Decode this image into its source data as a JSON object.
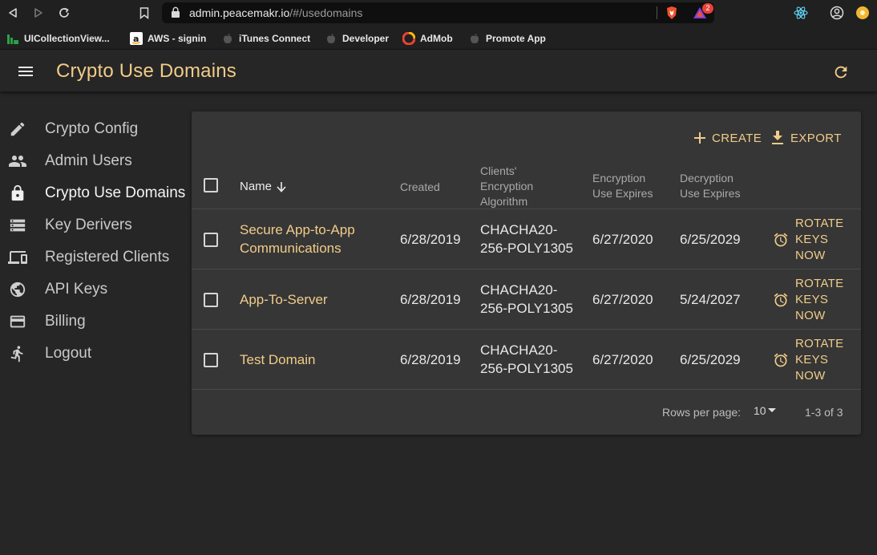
{
  "browser": {
    "url_domain": "admin.peacemakr.io",
    "url_path": "/#/usedomains",
    "shields_badge": "2",
    "bookmarks": [
      "UICollectionView...",
      "AWS - signin",
      "iTunes Connect",
      "Developer",
      "AdMob",
      "Promote App"
    ]
  },
  "appbar": {
    "title": "Crypto Use Domains",
    "menu_icon": "menu-icon",
    "refresh_icon": "refresh-icon"
  },
  "sidebar": {
    "items": [
      {
        "label": "Crypto Config",
        "icon": "pencil-icon",
        "active": false
      },
      {
        "label": "Admin Users",
        "icon": "people-icon",
        "active": false
      },
      {
        "label": "Crypto Use Domains",
        "icon": "lock-icon",
        "active": true
      },
      {
        "label": "Key Derivers",
        "icon": "storage-icon",
        "active": false
      },
      {
        "label": "Registered Clients",
        "icon": "devices-icon",
        "active": false
      },
      {
        "label": "API Keys",
        "icon": "globe-icon",
        "active": false
      },
      {
        "label": "Billing",
        "icon": "credit-card-icon",
        "active": false
      },
      {
        "label": "Logout",
        "icon": "run-icon",
        "active": false
      }
    ]
  },
  "toolbar": {
    "create_label": "CREATE",
    "export_label": "EXPORT"
  },
  "table": {
    "headers": {
      "name": "Name",
      "created": "Created",
      "algorithm": [
        "Clients'",
        "Encryption",
        "Algorithm"
      ],
      "encryption": [
        "Encryption",
        "Use Expires"
      ],
      "decryption": [
        "Decryption",
        "Use Expires"
      ]
    },
    "rows": [
      {
        "name": [
          "Secure App-to-App",
          "Communications"
        ],
        "created": "6/28/2019",
        "algorithm": [
          "CHACHA20-",
          "256-POLY1305"
        ],
        "encryption_expires": "6/27/2020",
        "decryption_expires": "6/25/2029",
        "action": [
          "ROTATE",
          "KEYS",
          "NOW"
        ]
      },
      {
        "name": [
          "App-To-Server"
        ],
        "created": "6/28/2019",
        "algorithm": [
          "CHACHA20-",
          "256-POLY1305"
        ],
        "encryption_expires": "6/27/2020",
        "decryption_expires": "5/24/2027",
        "action": [
          "ROTATE",
          "KEYS",
          "NOW"
        ]
      },
      {
        "name": [
          "Test Domain"
        ],
        "created": "6/28/2019",
        "algorithm": [
          "CHACHA20-",
          "256-POLY1305"
        ],
        "encryption_expires": "6/27/2020",
        "decryption_expires": "6/25/2029",
        "action": [
          "ROTATE",
          "KEYS",
          "NOW"
        ]
      }
    ]
  },
  "pagination": {
    "rows_per_page_label": "Rows per page:",
    "rows_per_page_value": "10",
    "range": "1-3 of 3"
  },
  "colors": {
    "accent": "#f1cc89",
    "background": "#262626",
    "card": "#363636"
  }
}
